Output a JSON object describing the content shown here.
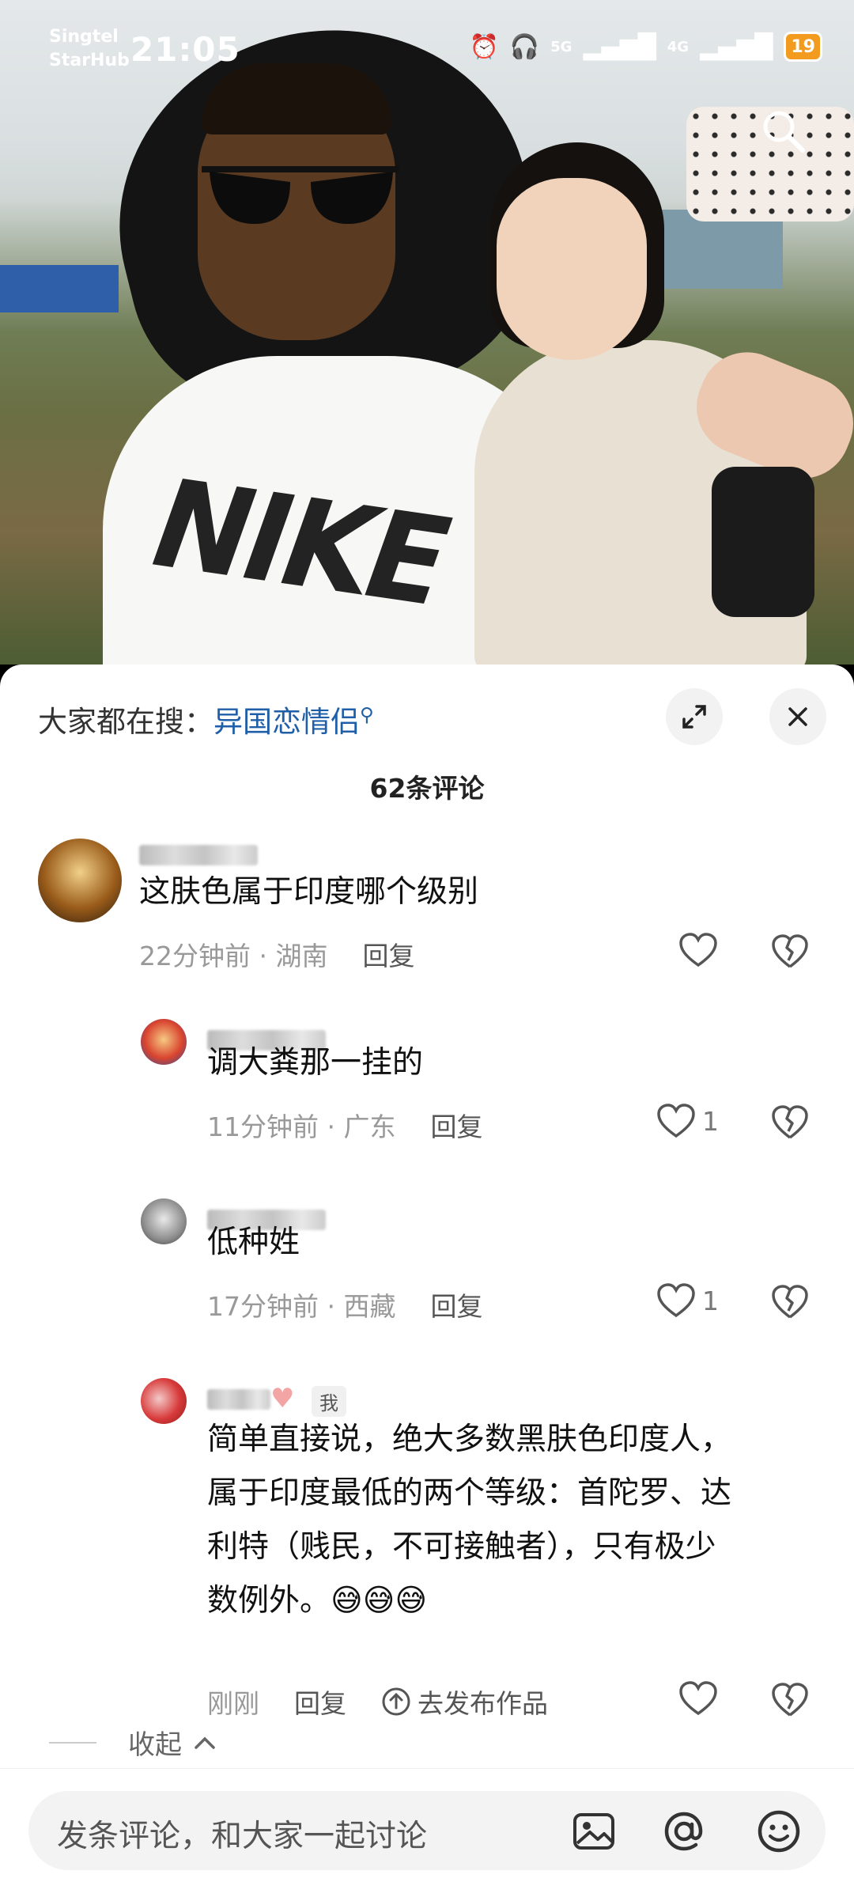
{
  "status_bar": {
    "carrier_1": "Singtel",
    "carrier_2": "StarHub",
    "time": "21:05",
    "network_1": "5G",
    "network_2": "4G",
    "battery": "19"
  },
  "header": {
    "search_prefix": "大家都在搜：",
    "search_keyword": "异国恋情侣",
    "expand_icon": "expand-icon",
    "close_icon": "close-icon"
  },
  "comments_count": "62条评论",
  "comments": [
    {
      "text": "这肤色属于印度哪个级别",
      "time": "22分钟前",
      "location": "湖南",
      "reply_label": "回复",
      "likes": ""
    },
    {
      "text": "调大粪那一挂的",
      "time": "11分钟前",
      "location": "广东",
      "reply_label": "回复",
      "likes": "1"
    },
    {
      "text": "低种姓",
      "time": "17分钟前",
      "location": "西藏",
      "reply_label": "回复",
      "likes": "1"
    },
    {
      "me_tag": "我",
      "text_lines": [
        "简单直接说，绝大多数黑肤色印度人，",
        "属于印度最低的两个等级：首陀罗、达",
        "利特（贱民，不可接触者），只有极少",
        "数例外。"
      ],
      "emoji": "😅😅😅",
      "time": "刚刚",
      "reply_label": "回复",
      "publish_label": "去发布作品"
    }
  ],
  "collapse_label": "收起",
  "input": {
    "placeholder": "发条评论，和大家一起讨论",
    "image_icon": "image-icon",
    "at_icon": "at-icon",
    "emoji_icon": "emoji-icon"
  },
  "photo_text": "NIKE",
  "colors": {
    "accent_blue": "#1f5fa8",
    "battery": "#f39b1f"
  }
}
